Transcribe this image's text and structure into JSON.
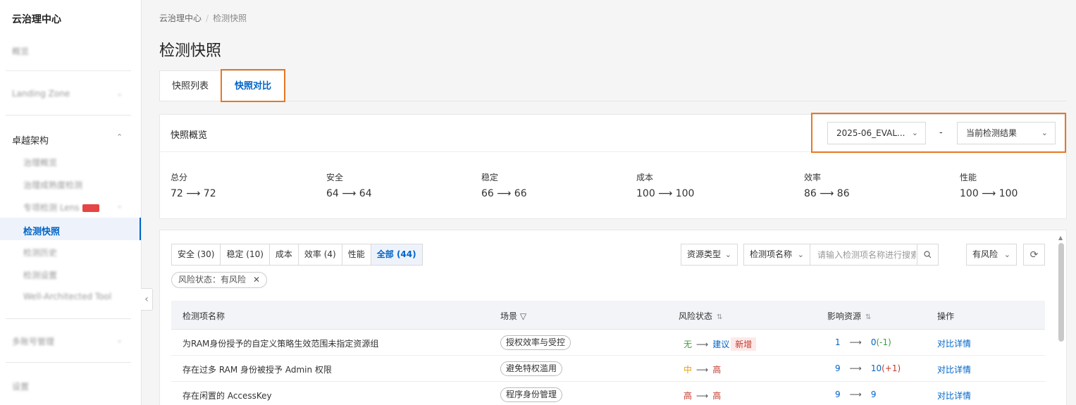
{
  "sidebar": {
    "title": "云治理中心",
    "items": [
      {
        "label": "概览"
      },
      {
        "label": "Landing Zone"
      },
      {
        "label": "卓越架构"
      },
      {
        "label": "治理概览"
      },
      {
        "label": "治理成熟度检测"
      },
      {
        "label": "专项检测 Lens"
      },
      {
        "label": "检测快照"
      },
      {
        "label": "检测历史"
      },
      {
        "label": "检测设置"
      },
      {
        "label": "Well-Architected Tool"
      },
      {
        "label": "多账号管理"
      },
      {
        "label": "设置"
      }
    ]
  },
  "breadcrumb": {
    "root": "云治理中心",
    "sep": "/",
    "current": "检测快照"
  },
  "page_title": "检测快照",
  "tabs": [
    {
      "label": "快照列表"
    },
    {
      "label": "快照对比"
    }
  ],
  "overview": {
    "title": "快照概览",
    "from_select": "2025-06_EVAL...",
    "dash": "-",
    "to_select": "当前检测结果",
    "metrics": [
      {
        "label": "总分",
        "value": "72 ⟶ 72"
      },
      {
        "label": "安全",
        "value": "64 ⟶ 64"
      },
      {
        "label": "稳定",
        "value": "66 ⟶ 66"
      },
      {
        "label": "成本",
        "value": "100 ⟶ 100"
      },
      {
        "label": "效率",
        "value": "86 ⟶ 86"
      },
      {
        "label": "性能",
        "value": "100 ⟶ 100"
      }
    ]
  },
  "filters": {
    "segments": [
      "安全 (30)",
      "稳定 (10)",
      "成本",
      "效率 (4)",
      "性能",
      "全部 (44)"
    ],
    "active_tag": "风险状态：有风险",
    "resource_type": "资源类型",
    "check_name_select": "检测项名称",
    "search_placeholder": "请输入检测项名称进行搜索",
    "risk_select": "有风险"
  },
  "table": {
    "headers": {
      "name": "检测项名称",
      "scene": "场景",
      "risk": "风险状态",
      "impact": "影响资源",
      "action": "操作"
    },
    "rows": [
      {
        "name": "为RAM身份授予的自定义策略生效范围未指定资源组",
        "scene": "授权效率与受控",
        "risk_from": "无",
        "risk_to": "建议",
        "tag": "新增",
        "res_from": "1",
        "res_to": "0",
        "res_delta": "(-1)",
        "action": "对比详情"
      },
      {
        "name": "存在过多 RAM 身份被授予 Admin 权限",
        "scene": "避免特权滥用",
        "risk_from": "中",
        "risk_to": "高",
        "tag": "",
        "res_from": "9",
        "res_to": "10",
        "res_delta": "(+1)",
        "action": "对比详情"
      },
      {
        "name": "存在闲置的 AccessKey",
        "scene": "程序身份管理",
        "risk_from": "高",
        "risk_to": "高",
        "tag": "",
        "res_from": "9",
        "res_to": "9",
        "res_delta": "",
        "action": "对比详情"
      }
    ]
  },
  "colors": {
    "accent": "#0064c8",
    "highlight": "#e87722",
    "high": "#c0392b",
    "mid": "#e8a010",
    "none": "#3aa03a"
  }
}
